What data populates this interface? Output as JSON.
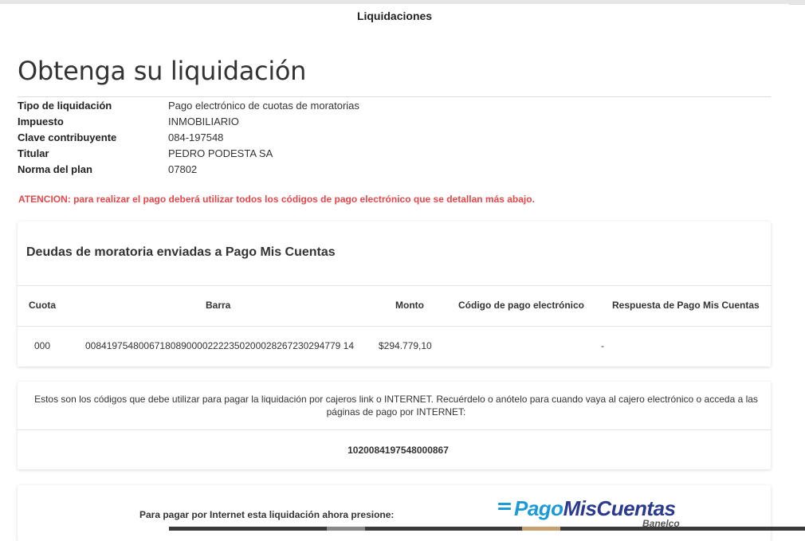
{
  "header": {
    "title": "Liquidaciones"
  },
  "page": {
    "heading": "Obtenga su liquidación"
  },
  "info": [
    {
      "label": "Tipo de liquidación",
      "value": "Pago electrónico de cuotas de moratorias"
    },
    {
      "label": "Impuesto",
      "value": "INMOBILIARIO"
    },
    {
      "label": "Clave contribuyente",
      "value": "084-197548"
    },
    {
      "label": "Titular",
      "value": "PEDRO PODESTA SA"
    },
    {
      "label": "Norma del plan",
      "value": "07802"
    }
  ],
  "warning": "ATENCION: para realizar el pago deberá utilizar todos los códigos de pago electrónico que se detallan más abajo.",
  "debts": {
    "title": "Deudas de moratoria enviadas a Pago Mis Cuentas",
    "columns": [
      "Cuota",
      "Barra",
      "Monto",
      "Código de pago electrónico",
      "Respuesta de Pago Mis Cuentas"
    ],
    "rows": [
      {
        "cuota": "000",
        "barra": "008419754800671808900002222350200028267230294779 14",
        "monto": "$294.779,10",
        "codigo": "",
        "respuesta": "-"
      }
    ]
  },
  "codes": {
    "message": "Estos son los códigos que debe utilizar para pagar la liquidación por cajeros link o INTERNET. Recuérdelo o anótelo para cuando vaya al cajero electrónico o acceda a las páginas de pago por INTERNET:",
    "code": "1020084197548000867"
  },
  "payment": {
    "prompt": "Para pagar por Internet esta liquidación ahora presione:",
    "logo_part1": "Pago",
    "logo_part2": "MisCuentas",
    "logo_sub": "Banelco"
  },
  "colors": {
    "warning": "#e5474a",
    "logo_blue": "#1a9bd7",
    "logo_navy": "#2b3a8c"
  }
}
